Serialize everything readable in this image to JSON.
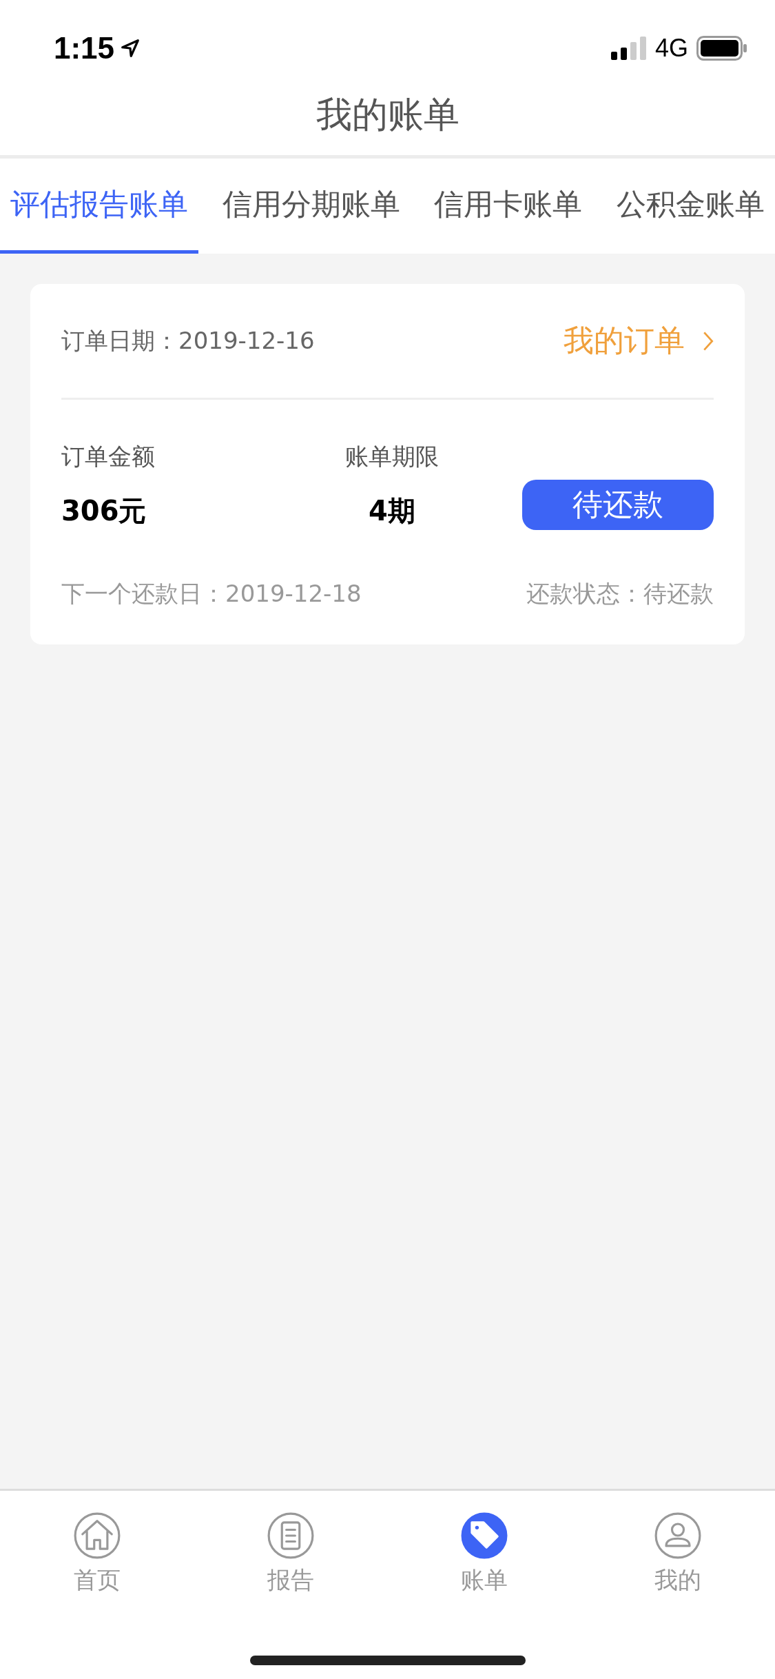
{
  "status_bar": {
    "time": "1:15",
    "network": "4G"
  },
  "header": {
    "title": "我的账单"
  },
  "tabs": [
    {
      "label": "评估报告账单",
      "selected": true
    },
    {
      "label": "信用分期账单",
      "selected": false
    },
    {
      "label": "信用卡账单",
      "selected": false
    },
    {
      "label": "公积金账单",
      "selected": false
    }
  ],
  "order": {
    "date": "订单日期：2019-12-16",
    "link": "我的订单",
    "amount_label": "订单金额",
    "amount": "306元",
    "term_label": "账单期限",
    "term": "4期",
    "action": "待还款",
    "next_date": "下一个还款日：2019-12-18",
    "status": "还款状态：待还款"
  },
  "tab_bar": [
    {
      "label": "首页",
      "kind": "home",
      "selected": false
    },
    {
      "label": "报告",
      "kind": "report",
      "selected": false
    },
    {
      "label": "账单",
      "kind": "bill",
      "selected": true
    },
    {
      "label": "我的",
      "kind": "profile",
      "selected": false
    }
  ]
}
